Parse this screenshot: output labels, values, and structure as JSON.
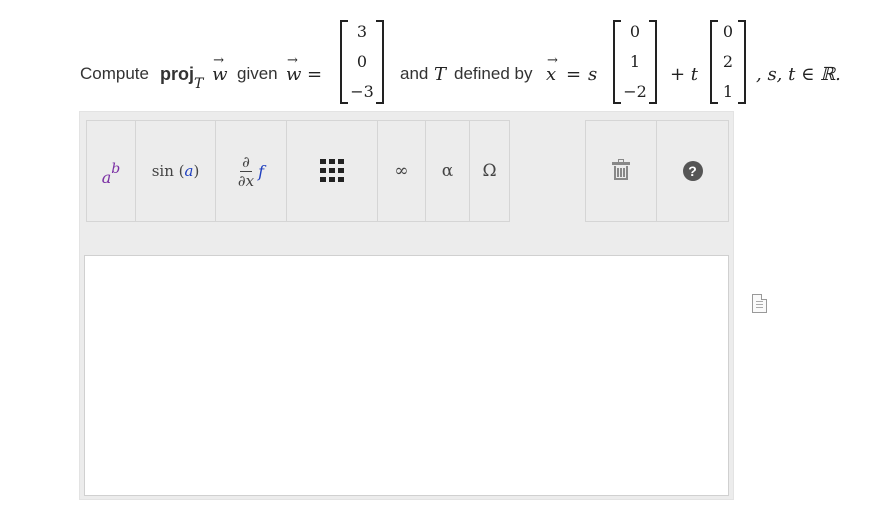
{
  "question": {
    "intro": "Compute",
    "proj": "proj",
    "proj_sub": "T",
    "w": "w",
    "given": "given",
    "equals": "=",
    "w_vector": [
      "3",
      "0",
      "−3"
    ],
    "and_text": "and",
    "T": "T",
    "defined_by": "defined by",
    "x": "x",
    "s": "s",
    "s_vector": [
      "0",
      "1",
      "−2"
    ],
    "plus_t": "+ t",
    "t_vector": [
      "0",
      "2",
      "1"
    ],
    "tail": ", s, t ∈ ℝ."
  },
  "toolbar": {
    "superscript": {
      "base": "a",
      "exp": "b"
    },
    "sin": {
      "fn": "sin",
      "arg": "a"
    },
    "derivative": {
      "num": "∂",
      "den": "∂x",
      "fn": "f"
    },
    "infinity": "∞",
    "alpha": "α",
    "omega": "Ω",
    "help": "?"
  },
  "colors": {
    "panel_bg": "#ececec",
    "purple": "#7a2ea3",
    "blue": "#1f3fbf"
  }
}
